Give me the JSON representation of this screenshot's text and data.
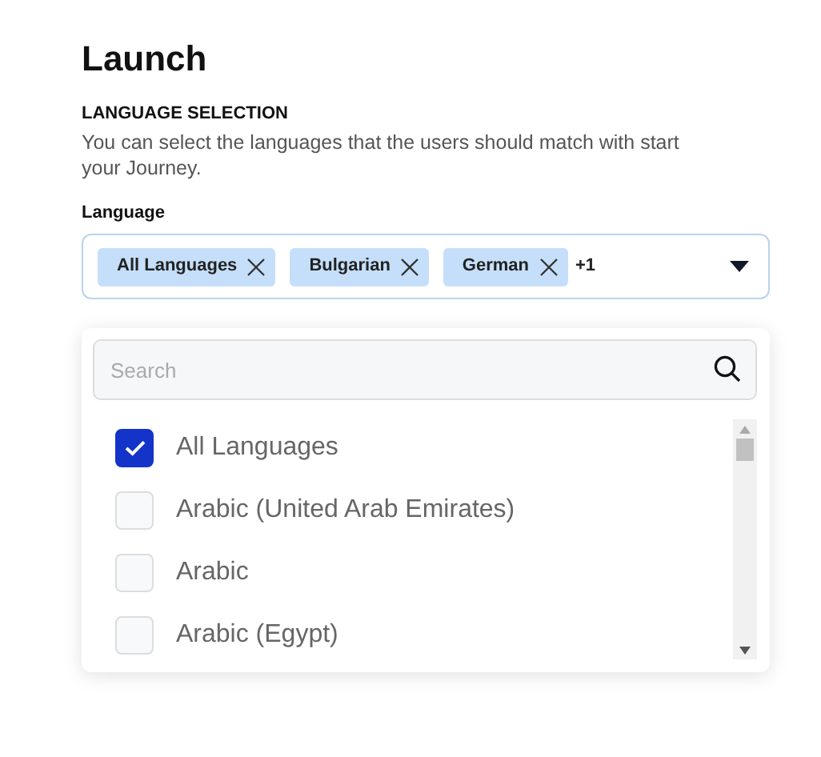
{
  "title": "Launch",
  "section": {
    "heading": "LANGUAGE SELECTION",
    "description": "You can select the languages that the users should match with start your Journey."
  },
  "field": {
    "label": "Language",
    "chips": [
      "All Languages",
      "Bulgarian",
      "German"
    ],
    "more": "+1",
    "expanded": true
  },
  "dropdown": {
    "search_placeholder": "Search",
    "options": [
      {
        "label": "All Languages",
        "checked": true
      },
      {
        "label": "Arabic (United Arab Emirates)",
        "checked": false
      },
      {
        "label": "Arabic",
        "checked": false
      },
      {
        "label": "Arabic (Egypt)",
        "checked": false
      }
    ]
  }
}
